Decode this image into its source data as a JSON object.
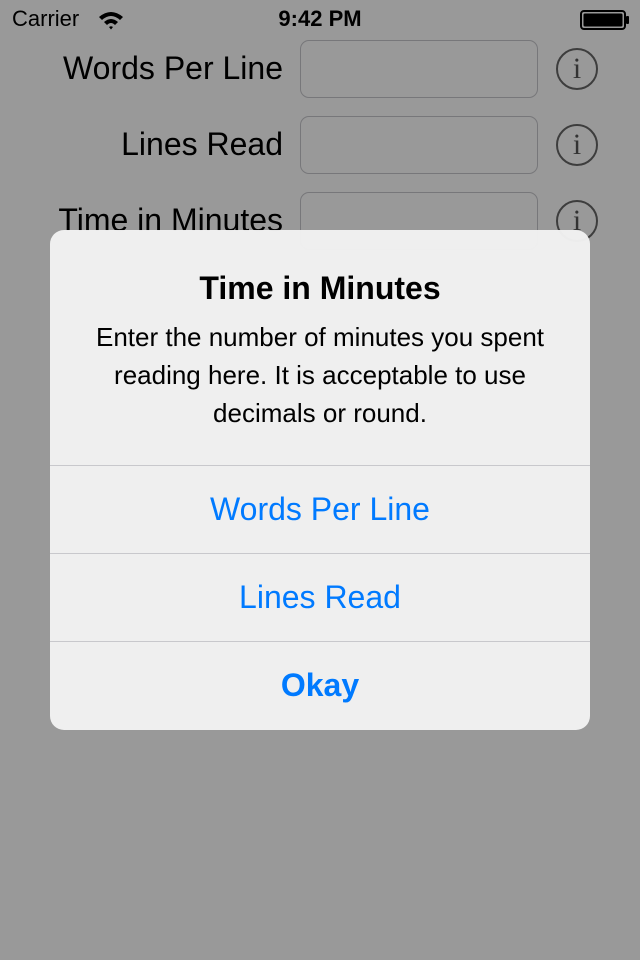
{
  "status_bar": {
    "carrier": "Carrier",
    "time": "9:42 PM"
  },
  "form": {
    "rows": [
      {
        "label": "Words Per Line",
        "value": "",
        "info_icon": "info-circle-icon"
      },
      {
        "label": "Lines Read",
        "value": "",
        "info_icon": "info-circle-icon"
      },
      {
        "label": "Time in Minutes",
        "value": "",
        "info_icon": "info-circle-icon"
      }
    ],
    "info_glyph": "i"
  },
  "alert": {
    "title": "Time in Minutes",
    "message": "Enter the number of minutes you spent reading here. It is acceptable to use decimals or round.",
    "buttons": [
      {
        "label": "Words Per Line"
      },
      {
        "label": "Lines Read"
      },
      {
        "label": "Okay"
      }
    ]
  },
  "colors": {
    "accent": "#007aff",
    "overlay": "rgba(0,0,0,0.40)",
    "alert_background": "#f2f2f2"
  }
}
